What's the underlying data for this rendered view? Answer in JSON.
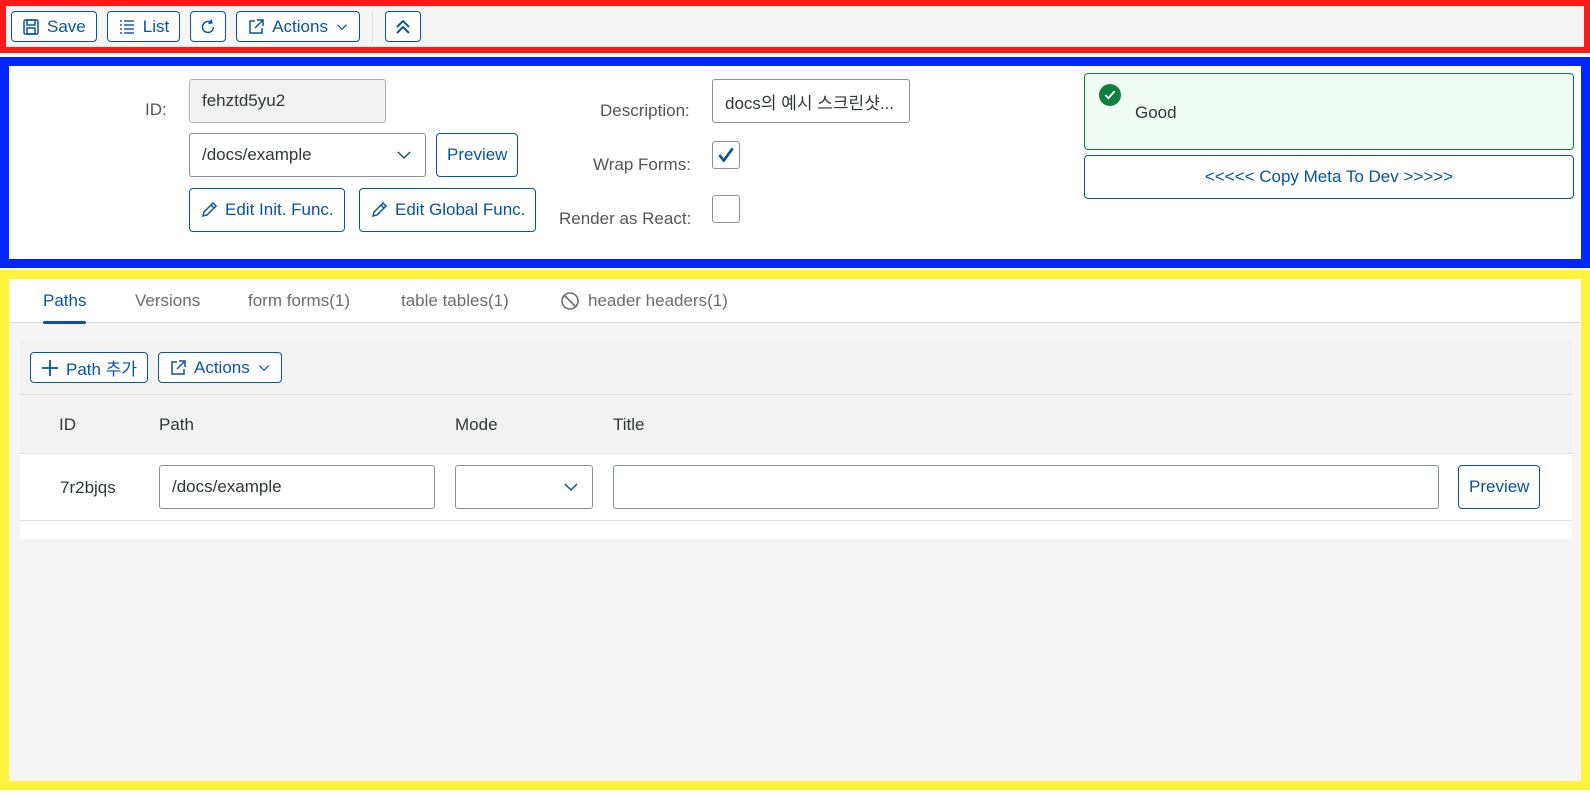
{
  "toolbar": {
    "save_label": "Save",
    "list_label": "List",
    "actions_label": "Actions"
  },
  "header": {
    "id_label": "ID:",
    "id_value": "fehztd5yu2",
    "path_value": "/docs/example",
    "preview_label": "Preview",
    "edit_init_label": "Edit Init. Func.",
    "edit_global_label": "Edit Global Func.",
    "description_label": "Description:",
    "description_value": "docs의 예시 스크린샷...",
    "wrap_forms_label": "Wrap Forms:",
    "wrap_forms_checked": true,
    "render_react_label": "Render as React:",
    "render_react_checked": false,
    "status_text": "Good",
    "status_color": "#107e3e",
    "copy_meta_label": "<<<<< Copy Meta To Dev >>>>>"
  },
  "tabs": [
    {
      "label": "Paths",
      "active": true
    },
    {
      "label": "Versions",
      "active": false
    },
    {
      "label": "form forms(1)",
      "active": false
    },
    {
      "label": "table tables(1)",
      "active": false
    },
    {
      "label": "header headers(1)",
      "active": false,
      "icon": "blocked-icon"
    }
  ],
  "paths_table": {
    "add_label": "Path 추가",
    "actions_label": "Actions",
    "columns": [
      "ID",
      "Path",
      "Mode",
      "Title"
    ],
    "rows": [
      {
        "id": "7r2bjqs",
        "path": "/docs/example",
        "mode": "",
        "title": "",
        "preview_label": "Preview"
      }
    ]
  },
  "colors": {
    "accent": "#0854a0",
    "toolbar_frame": "#ff1a1a",
    "header_frame": "#0026ff",
    "content_frame": "#fff43b"
  }
}
